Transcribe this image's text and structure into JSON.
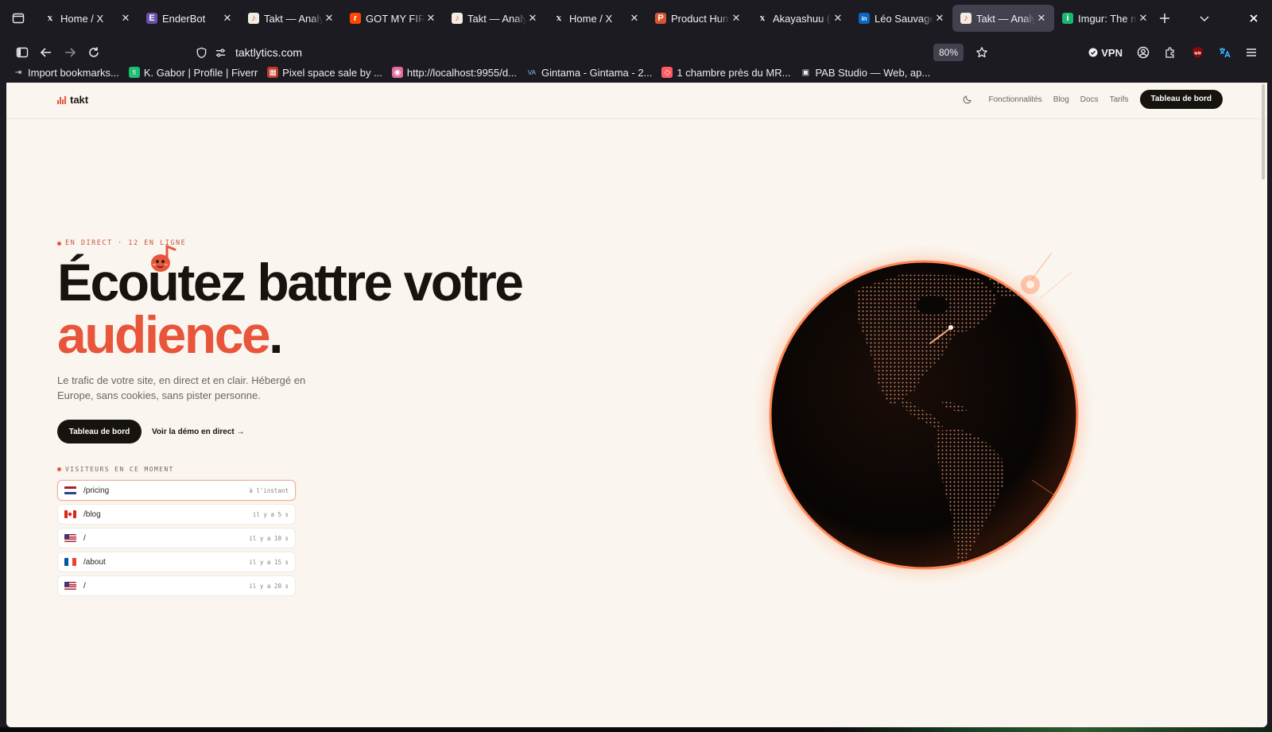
{
  "browser": {
    "tabs": [
      {
        "title": "Home / X",
        "favicon": "x-logo-icon",
        "active": false
      },
      {
        "title": "EnderBot",
        "favicon": "enderbot-icon",
        "active": false
      },
      {
        "title": "Takt — Analytics",
        "favicon": "takt-icon",
        "active": false
      },
      {
        "title": "GOT MY FIRST",
        "favicon": "reddit-icon",
        "active": false
      },
      {
        "title": "Takt — Analytics",
        "favicon": "takt-icon",
        "active": false
      },
      {
        "title": "Home / X",
        "favicon": "x-logo-icon",
        "active": false
      },
      {
        "title": "Product Hunt",
        "favicon": "producthunt-icon",
        "active": false
      },
      {
        "title": "Akayashuu (@",
        "favicon": "x-logo-icon",
        "active": false
      },
      {
        "title": "Léo Sauvage |",
        "favicon": "linkedin-icon",
        "active": false
      },
      {
        "title": "Takt — Analytics",
        "favicon": "takt-icon",
        "active": true
      },
      {
        "title": "Imgur: The ma",
        "favicon": "imgur-icon",
        "active": false
      }
    ],
    "url": "taktlytics.com",
    "zoom": "80%",
    "vpn_label": "VPN",
    "bookmarks": [
      {
        "label": "Import bookmarks...",
        "icon": "import-icon"
      },
      {
        "label": "K. Gabor | Profile | Fiverr",
        "icon": "fiverr-icon"
      },
      {
        "label": "Pixel space sale by ...",
        "icon": "pixel-icon"
      },
      {
        "label": "http://localhost:9955/d...",
        "icon": "localhost-icon"
      },
      {
        "label": "Gintama - Gintama - 2...",
        "icon": "gintama-icon"
      },
      {
        "label": "1 chambre près du MR...",
        "icon": "airbnb-icon"
      },
      {
        "label": "PAB Studio — Web, ap...",
        "icon": "pab-icon"
      }
    ]
  },
  "site": {
    "brand": "takt",
    "nav": {
      "features": "Fonctionnalités",
      "blog": "Blog",
      "docs": "Docs",
      "pricing": "Tarifs",
      "cta": "Tableau de bord"
    },
    "hero": {
      "live_tag": "EN DIRECT · 12 EN LIGNE",
      "title_line1": "Écoutez battre votre",
      "title_accent": "audience",
      "title_period": ".",
      "subtitle": "Le trafic de votre site, en direct et en clair. Hébergé en Europe, sans cookies, sans pister personne.",
      "primary_cta": "Tableau de bord",
      "secondary_cta": "Voir la démo en direct →"
    },
    "visitors": {
      "label": "VISITEURS EN CE MOMENT",
      "rows": [
        {
          "flag": "nl",
          "path": "/pricing",
          "time": "à l'instant"
        },
        {
          "flag": "ca",
          "path": "/blog",
          "time": "il y a 5 s"
        },
        {
          "flag": "us",
          "path": "/",
          "time": "il y a 10 s"
        },
        {
          "flag": "fr",
          "path": "/about",
          "time": "il y a 15 s"
        },
        {
          "flag": "us",
          "path": "/",
          "time": "il y a 20 s"
        }
      ]
    },
    "colors": {
      "accent": "#e8553b",
      "ink": "#17130f",
      "background": "#faf6ef"
    }
  }
}
